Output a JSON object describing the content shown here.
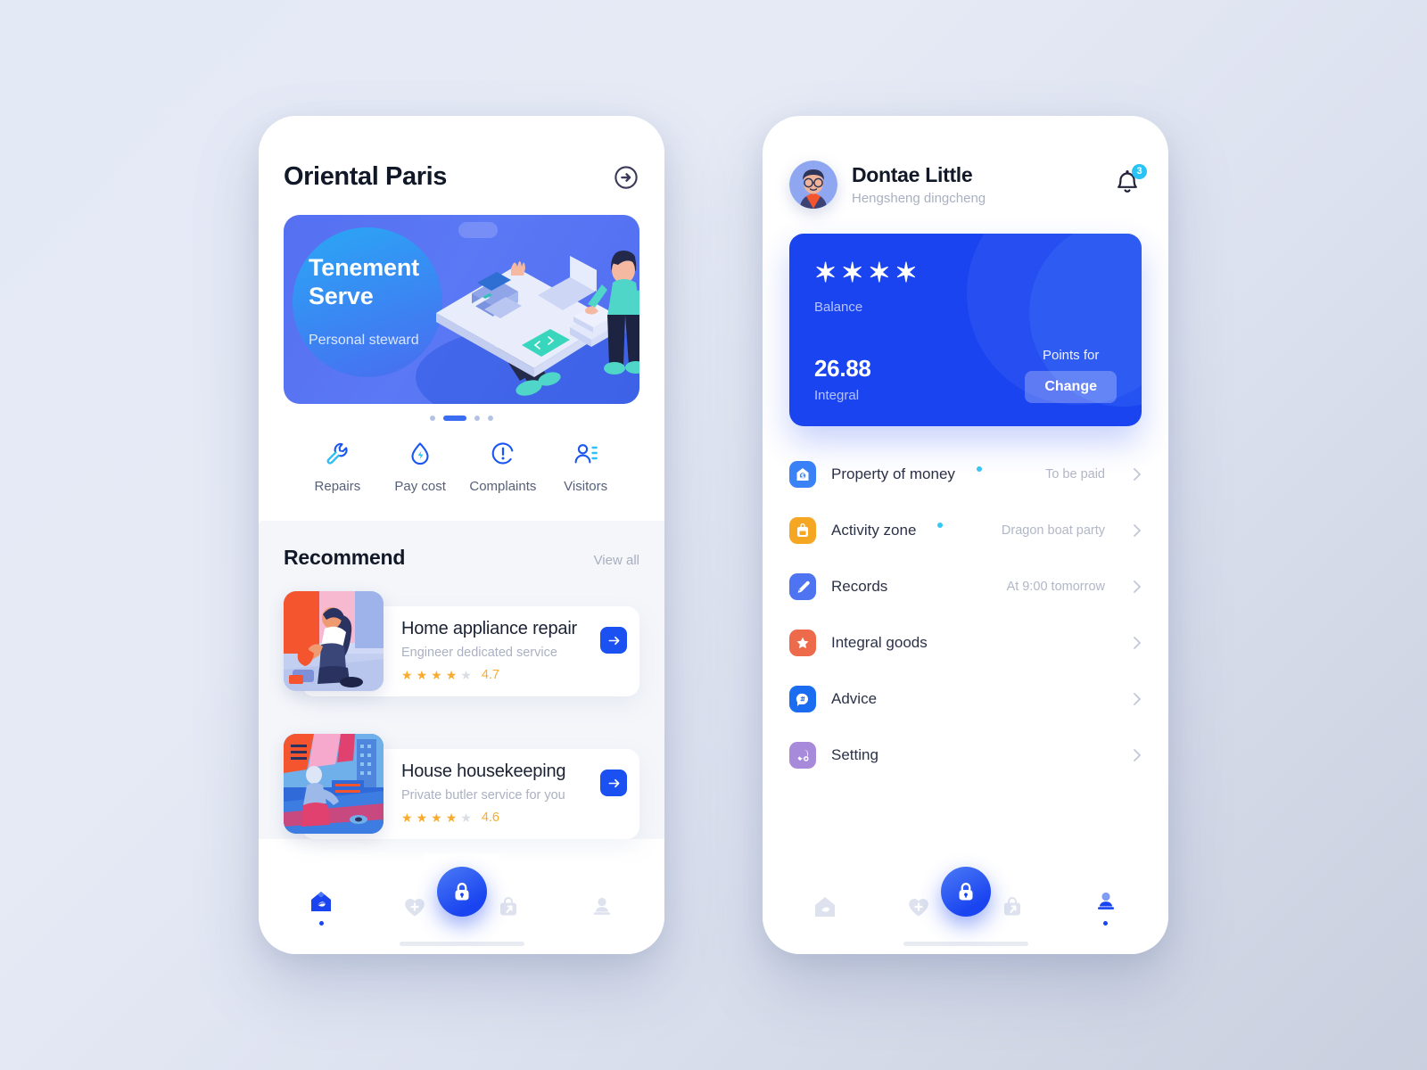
{
  "left_phone": {
    "header": {
      "title": "Oriental Paris",
      "action_icon": "circle-arrow-right-icon"
    },
    "hero": {
      "heading_line1": "Tenement",
      "heading_line2": "Serve",
      "subtitle": "Personal steward",
      "colors": {
        "bg": "#5570f1",
        "blob": "#2aa8f5"
      }
    },
    "carousel": {
      "count": 4,
      "active_index": 1
    },
    "quick_actions": [
      {
        "label": "Repairs",
        "icon": "wrench-icon"
      },
      {
        "label": "Pay cost",
        "icon": "water-drop-bolt-icon"
      },
      {
        "label": "Complaints",
        "icon": "exclamation-circle-icon"
      },
      {
        "label": "Visitors",
        "icon": "visitor-person-icon"
      }
    ],
    "recommend": {
      "title": "Recommend",
      "view_all": "View all",
      "items": [
        {
          "name": "Home appliance repair",
          "desc": "Engineer dedicated service",
          "rating": 4,
          "score": "4.7",
          "go_icon": "arrow-right-icon"
        },
        {
          "name": "House housekeeping",
          "desc": "Private butler service for you",
          "rating": 4,
          "score": "4.6",
          "go_icon": "arrow-right-icon"
        }
      ]
    },
    "tabbar": {
      "active": "home",
      "items": [
        {
          "name": "home",
          "icon": "home-leaf-icon"
        },
        {
          "name": "health",
          "icon": "heart-plus-icon"
        },
        {
          "name": "shop",
          "icon": "shopping-bag-icon"
        },
        {
          "name": "profile",
          "icon": "person-stamp-icon"
        }
      ],
      "fab_icon": "lock-icon"
    }
  },
  "right_phone": {
    "user": {
      "name": "Dontae Little",
      "subtitle": "Hengsheng dingcheng",
      "avatar_icon": "user-avatar",
      "bell_icon": "bell-icon",
      "bell_badge": "3"
    },
    "balance_card": {
      "masked_balance": "✶✶✶✶",
      "balance_label": "Balance",
      "integral_value": "26.88",
      "integral_label": "Integral",
      "points_label": "Points for",
      "change_button": "Change",
      "bg_color": "#1a44f0"
    },
    "menu": [
      {
        "label": "Property of money",
        "value": "To be paid",
        "icon": "house-money-icon",
        "icon_color": "#3b82f6",
        "dot": true
      },
      {
        "label": "Activity zone",
        "value": "Dragon boat party",
        "icon": "activity-bag-icon",
        "icon_color": "#f5a623",
        "dot": true
      },
      {
        "label": "Records",
        "value": "At 9:00 tomorrow",
        "icon": "records-pen-icon",
        "icon_color": "#4f74f2",
        "dot": false
      },
      {
        "label": "Integral goods",
        "value": "",
        "icon": "star-badge-icon",
        "icon_color": "#ed6a4a",
        "dot": false
      },
      {
        "label": "Advice",
        "value": "",
        "icon": "advice-chat-icon",
        "icon_color": "#1a6cf0",
        "dot": false
      },
      {
        "label": "Setting",
        "value": "",
        "icon": "setting-gear-icon",
        "icon_color": "#a78bda",
        "dot": false
      }
    ],
    "tabbar": {
      "active": "profile",
      "items": [
        {
          "name": "home",
          "icon": "home-leaf-icon"
        },
        {
          "name": "health",
          "icon": "heart-plus-icon"
        },
        {
          "name": "shop",
          "icon": "shopping-bag-icon"
        },
        {
          "name": "profile",
          "icon": "person-stamp-icon"
        }
      ],
      "fab_icon": "lock-icon"
    }
  }
}
